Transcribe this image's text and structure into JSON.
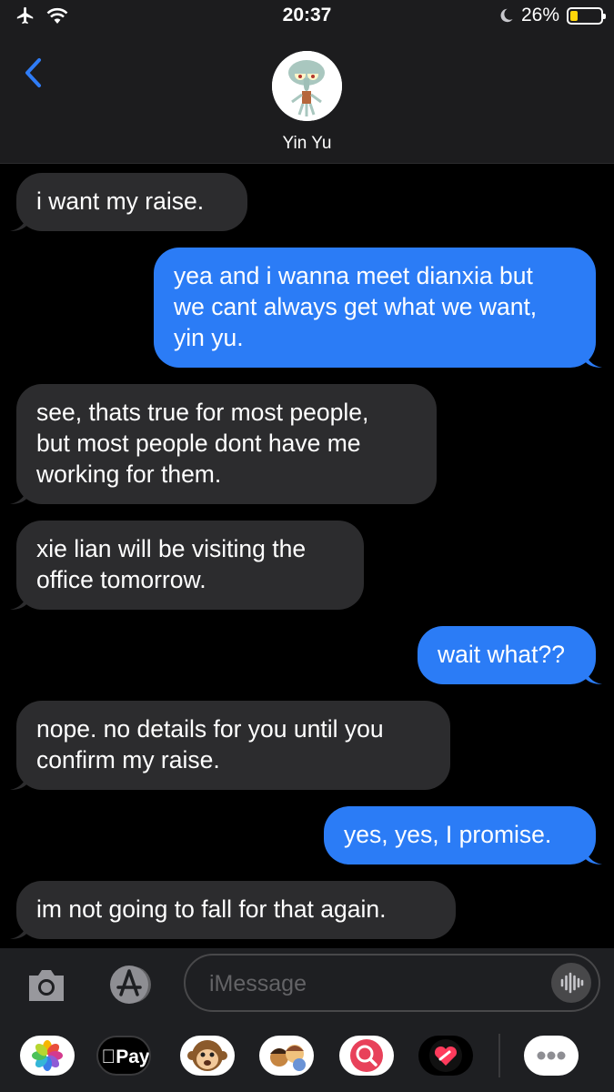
{
  "status_bar": {
    "time": "20:37",
    "battery_percent": "26%",
    "battery_level": 0.26,
    "icons": [
      "airplane-icon",
      "wifi-icon",
      "moon-icon",
      "battery-icon"
    ]
  },
  "header": {
    "back_icon": "chevron-left-icon",
    "contact_name": "Yin Yu",
    "avatar": "contact-avatar"
  },
  "messages": [
    {
      "direction": "incoming",
      "lines": [
        "i want my raise."
      ]
    },
    {
      "direction": "outgoing",
      "lines": [
        "yea and i wanna meet dianxia but",
        "we cant always get what we want,",
        "yin yu."
      ]
    },
    {
      "direction": "incoming",
      "lines": [
        "see, thats true for most people,",
        "but most people dont have me",
        "working for them."
      ]
    },
    {
      "direction": "incoming",
      "lines": [
        "xie lian will be visiting the",
        "office tomorrow."
      ]
    },
    {
      "direction": "outgoing",
      "lines": [
        "wait what??"
      ]
    },
    {
      "direction": "incoming",
      "lines": [
        "nope. no details for you until you",
        "confirm my raise."
      ]
    },
    {
      "direction": "outgoing",
      "lines": [
        "yes, yes, I promise."
      ]
    },
    {
      "direction": "incoming",
      "lines": [
        "im not going to fall for that again."
      ]
    }
  ],
  "input_bar": {
    "placeholder": "iMessage",
    "icons": [
      "camera-icon",
      "app-store-icon",
      "audio-waveform-icon"
    ]
  },
  "app_drawer": {
    "apple_pay_label": "Pay",
    "apps": [
      "photos-app-icon",
      "apple-pay-icon",
      "animoji-icon",
      "memoji-stickers-icon",
      "web-search-icon",
      "digital-touch-icon",
      "more-apps-icon"
    ]
  },
  "colors": {
    "outgoing_bubble": "#2b7cf6",
    "incoming_bubble": "#2c2c2e",
    "accent": "#2f7cf6",
    "background": "#000000"
  }
}
